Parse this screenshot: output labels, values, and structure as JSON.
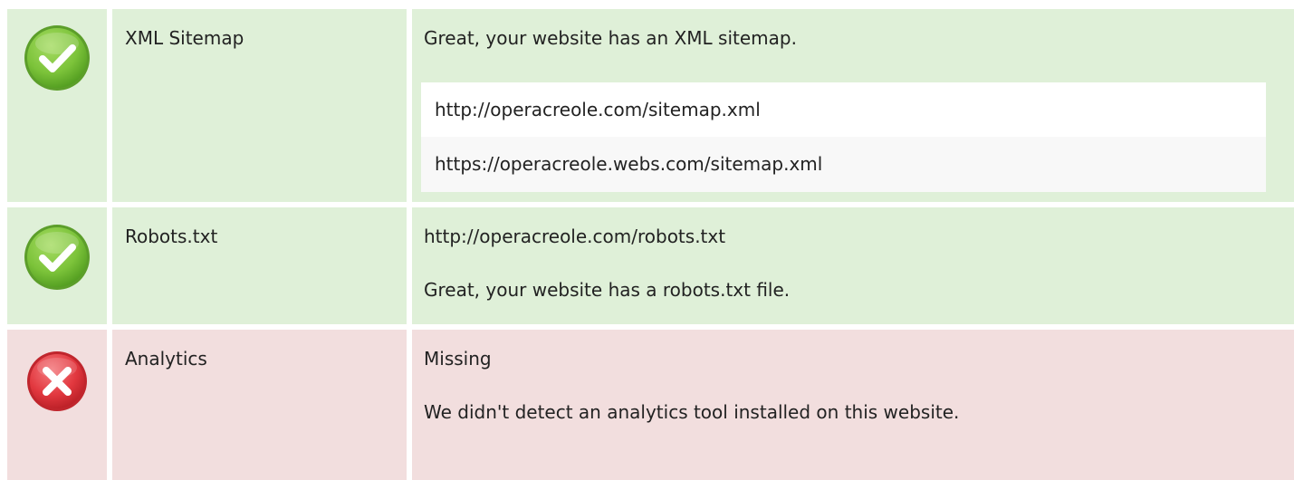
{
  "checks": {
    "sitemap": {
      "status_icon": "check-icon",
      "label": "XML Sitemap",
      "message": "Great, your website has an XML sitemap.",
      "urls": [
        "http://operacreole.com/sitemap.xml",
        "https://operacreole.webs.com/sitemap.xml"
      ]
    },
    "robots": {
      "status_icon": "check-icon",
      "label": "Robots.txt",
      "url": "http://operacreole.com/robots.txt",
      "message": "Great, your website has a robots.txt file."
    },
    "analytics": {
      "status_icon": "cross-icon",
      "label": "Analytics",
      "value": "Missing",
      "message": "We didn't detect an analytics tool installed on this website."
    }
  },
  "colors": {
    "pass_background": "#dff0d8",
    "fail_background": "#f2dede",
    "pass_icon": "#7cc33a",
    "fail_icon": "#e2383f"
  }
}
